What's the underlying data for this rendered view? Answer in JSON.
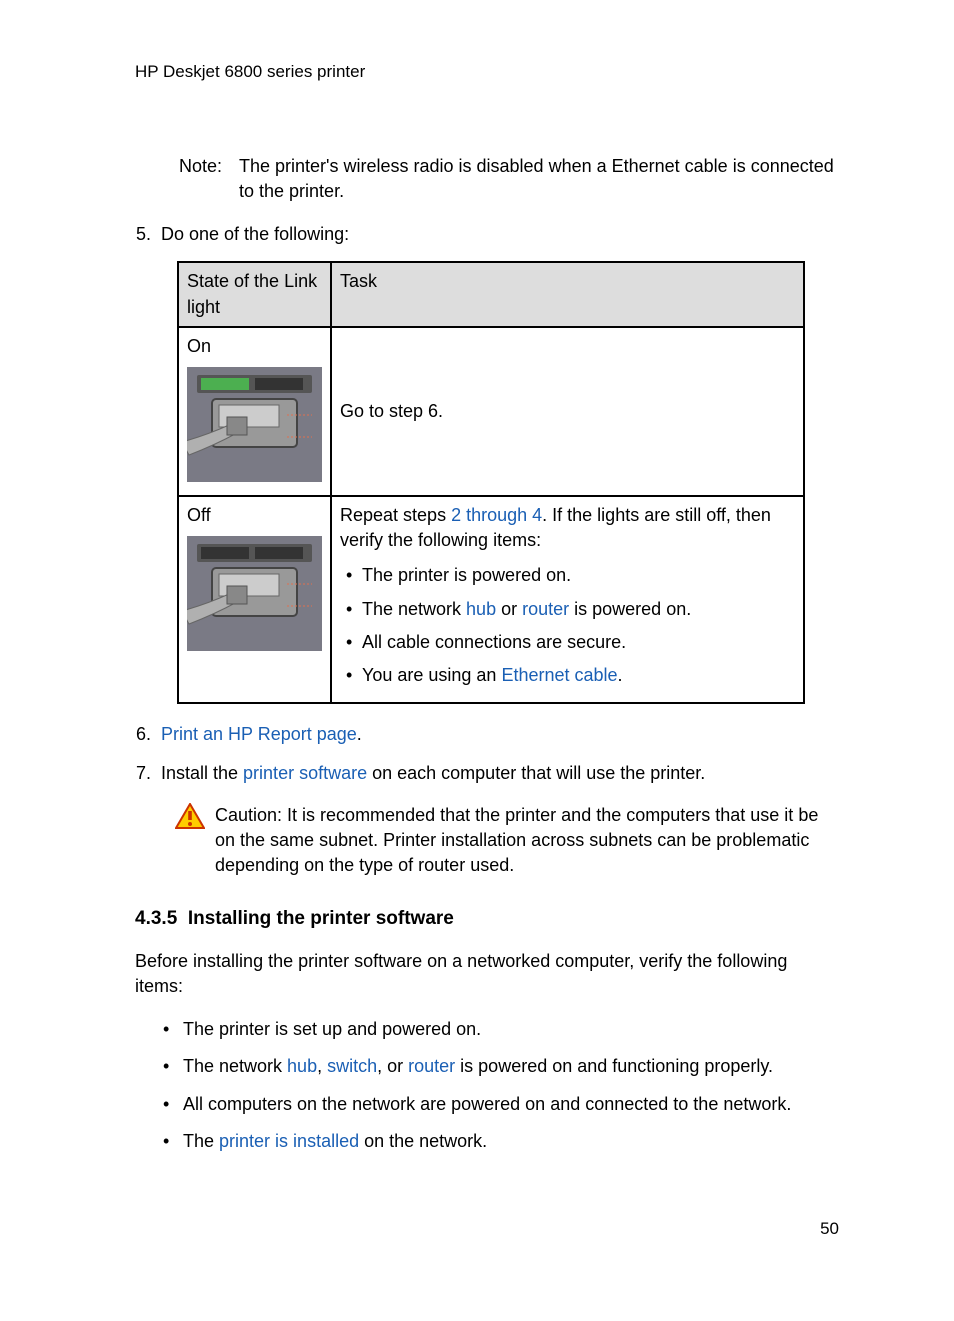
{
  "header": "HP Deskjet 6800 series printer",
  "note": {
    "label": "Note:",
    "text": "The printer's wireless radio is disabled when a Ethernet cable is connected to the printer."
  },
  "step5": {
    "num": "5.",
    "text": "Do one of the following:"
  },
  "table": {
    "header_state": "State of the Link light",
    "header_task": "Task",
    "on_label": "On",
    "on_task": "Go to step 6.",
    "off_label": "Off",
    "off_repeat_1": "Repeat steps ",
    "off_repeat_link": "2 through 4",
    "off_repeat_2": ". If the lights are still off, then verify the following items:",
    "off_items": {
      "a": "The printer is powered on.",
      "b_1": "The network ",
      "b_hub": "hub",
      "b_2": " or ",
      "b_router": "router",
      "b_3": " is powered on.",
      "c": "All cable connections are secure.",
      "d_1": "You are using an ",
      "d_link": "Ethernet cable",
      "d_2": "."
    }
  },
  "step6": {
    "num": "6.",
    "link": "Print an HP Report page",
    "suffix": "."
  },
  "step7": {
    "num": "7.",
    "pre": "Install the ",
    "link": "printer software",
    "post": " on each computer that will use the printer."
  },
  "caution": "Caution: It is recommended that the printer and the computers that use it be on the same subnet. Printer installation across subnets can be problematic depending on the type of router used.",
  "section": {
    "num": "4.3.5",
    "title": "Installing the printer software"
  },
  "intro": "Before installing the printer software on a networked computer, verify the following items:",
  "bullets": {
    "a": "The printer is set up and powered on.",
    "b_1": "The network ",
    "b_hub": "hub",
    "b_c1": ", ",
    "b_switch": "switch",
    "b_c2": ", or ",
    "b_router": "router",
    "b_3": " is powered on and functioning properly.",
    "c": "All computers on the network are powered on and connected to the network.",
    "d_1": "The ",
    "d_link": "printer is installed",
    "d_2": " on the network."
  },
  "page_num": "50"
}
